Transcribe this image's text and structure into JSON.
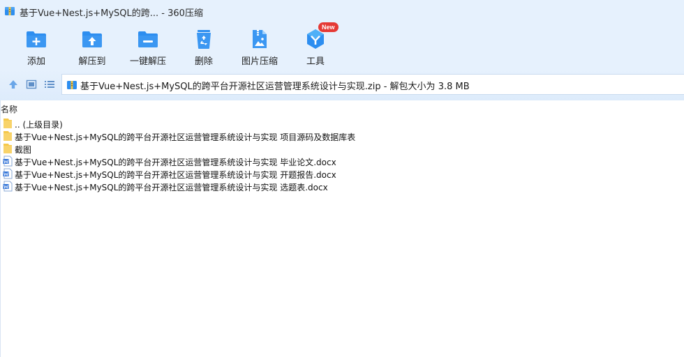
{
  "window": {
    "title": "基于Vue+Nest.js+MySQL的跨... - 360压缩"
  },
  "toolbar": {
    "buttons": [
      {
        "label": "添加",
        "icon": "add-folder-icon"
      },
      {
        "label": "解压到",
        "icon": "extract-to-folder-icon"
      },
      {
        "label": "一键解压",
        "icon": "one-click-extract-icon"
      },
      {
        "label": "删除",
        "icon": "recycle-bin-icon"
      },
      {
        "label": "图片压缩",
        "icon": "image-compress-icon"
      },
      {
        "label": "工具",
        "icon": "tools-icon",
        "badge": "New"
      }
    ]
  },
  "nav": {
    "path": "基于Vue+Nest.js+MySQL的跨平台开源社区运营管理系统设计与实现.zip - 解包大小为 3.8 MB"
  },
  "list": {
    "column_name": "名称",
    "rows": [
      {
        "name": ".. (上级目录)",
        "icon": "folder-icon"
      },
      {
        "name": "基于Vue+Nest.js+MySQL的跨平台开源社区运营管理系统设计与实现 项目源码及数据库表",
        "icon": "folder-icon"
      },
      {
        "name": "截图",
        "icon": "folder-icon"
      },
      {
        "name": "基于Vue+Nest.js+MySQL的跨平台开源社区运营管理系统设计与实现 毕业论文.docx",
        "icon": "word-doc-icon"
      },
      {
        "name": "基于Vue+Nest.js+MySQL的跨平台开源社区运营管理系统设计与实现 开题报告.docx",
        "icon": "word-doc-icon"
      },
      {
        "name": "基于Vue+Nest.js+MySQL的跨平台开源社区运营管理系统设计与实现 选题表.docx",
        "icon": "word-doc-icon"
      }
    ]
  },
  "colors": {
    "accent_blue": "#2d8ef0",
    "toolbar_bg": "#e6f1fd",
    "badge_red": "#e53935",
    "folder_yellow": "#f5c84a",
    "word_blue": "#2b6fd6"
  }
}
